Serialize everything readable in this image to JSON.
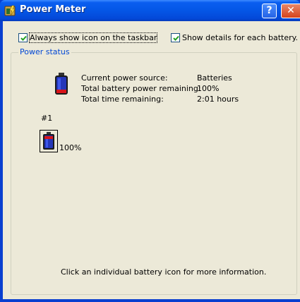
{
  "window": {
    "title": "Power Meter",
    "icon": "power-meter-icon",
    "help_label": "?",
    "close_label": "✕"
  },
  "options": {
    "always_show_icon": {
      "label": "Always show icon on the taskbar",
      "checked": true
    },
    "show_details": {
      "label": "Show details for each battery.",
      "checked": true
    }
  },
  "power_status": {
    "group_title": "Power status",
    "rows": [
      {
        "label": "Current power source:",
        "value": "Batteries"
      },
      {
        "label": "Total battery power remaining:",
        "value": "100%"
      },
      {
        "label": "Total time remaining:",
        "value": "2:01 hours"
      }
    ]
  },
  "battery": {
    "number": "#1",
    "percent": "100%",
    "icon": "battery-icon",
    "level": 1.0
  },
  "footer": {
    "hint": "Click an individual battery icon for more information."
  },
  "colors": {
    "titlebar": "#0456e6",
    "client_bg": "#ece9d8",
    "group_title": "#0046d5",
    "battery_blue": "#2436b8",
    "battery_red": "#d8141a"
  }
}
